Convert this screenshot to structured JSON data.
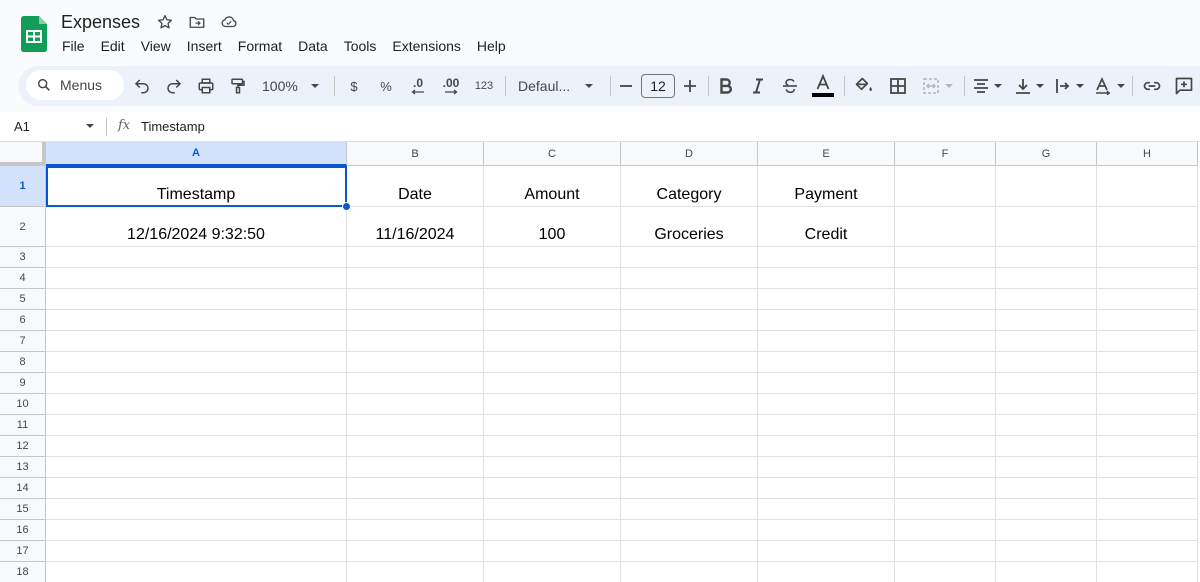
{
  "app": {
    "doc_title": "Expenses",
    "menu": [
      "File",
      "Edit",
      "View",
      "Insert",
      "Format",
      "Data",
      "Tools",
      "Extensions",
      "Help"
    ]
  },
  "toolbar": {
    "search_label": "Menus",
    "zoom": "100%",
    "currency": "$",
    "percent": "%",
    "decrease_decimal": ".0",
    "increase_decimal": ".00",
    "number_format": "123",
    "font": "Defaul...",
    "font_size": "12"
  },
  "formula_bar": {
    "name_box": "A1",
    "fx": "fx",
    "formula": "Timestamp"
  },
  "grid": {
    "columns": [
      "A",
      "B",
      "C",
      "D",
      "E",
      "F",
      "G",
      "H"
    ],
    "rows": [
      "1",
      "2",
      "3",
      "4",
      "5",
      "6",
      "7",
      "8",
      "9",
      "10",
      "11",
      "12",
      "13",
      "14",
      "15",
      "16",
      "17",
      "18"
    ],
    "cells": [
      [
        "Timestamp",
        "Date",
        "Amount",
        "Category",
        "Payment",
        "",
        "",
        ""
      ],
      [
        "12/16/2024 9:32:50",
        "11/16/2024",
        "100",
        "Groceries",
        "Credit",
        "",
        "",
        ""
      ]
    ],
    "selected_cell": "A1"
  },
  "colors": {
    "accent": "#0b57d0",
    "sheets_green": "#0f9d58",
    "toolbar_bg": "#edf2fa",
    "header_bg": "#f9fbfd"
  }
}
